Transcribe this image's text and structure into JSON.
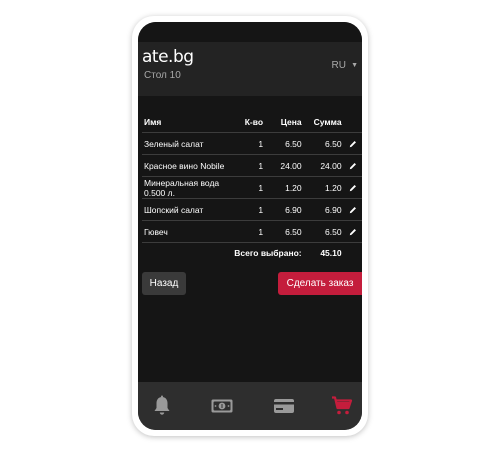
{
  "header": {
    "logo": "ate.bg",
    "table_label": "Стол 10",
    "language": "RU"
  },
  "order": {
    "columns": [
      "Имя",
      "К-во",
      "Цена",
      "Сумма"
    ],
    "rows": [
      {
        "name": "Зеленый салат",
        "qty": "1",
        "price": "6.50",
        "sum": "6.50"
      },
      {
        "name": "Красное вино Nobile",
        "qty": "1",
        "price": "24.00",
        "sum": "24.00"
      },
      {
        "name": "Минеральная вода 0.500 л.",
        "qty": "1",
        "price": "1.20",
        "sum": "1.20"
      },
      {
        "name": "Шопский салат",
        "qty": "1",
        "price": "6.90",
        "sum": "6.90"
      },
      {
        "name": "Гювеч",
        "qty": "1",
        "price": "6.50",
        "sum": "6.50"
      }
    ],
    "total_label": "Всего выбрано:",
    "total_value": "45.10"
  },
  "actions": {
    "back_label": "Назад",
    "order_label": "Сделать заказ"
  },
  "nav": {
    "items": [
      {
        "icon": "bell-icon"
      },
      {
        "icon": "cash-icon"
      },
      {
        "icon": "credit-card-icon"
      },
      {
        "icon": "cart-icon",
        "active": true
      }
    ]
  },
  "colors": {
    "accent": "#c41d3c",
    "background": "#151515",
    "header": "#232323",
    "nav_background": "#2e2e2e",
    "nav_icon": "#9a9a9a"
  }
}
